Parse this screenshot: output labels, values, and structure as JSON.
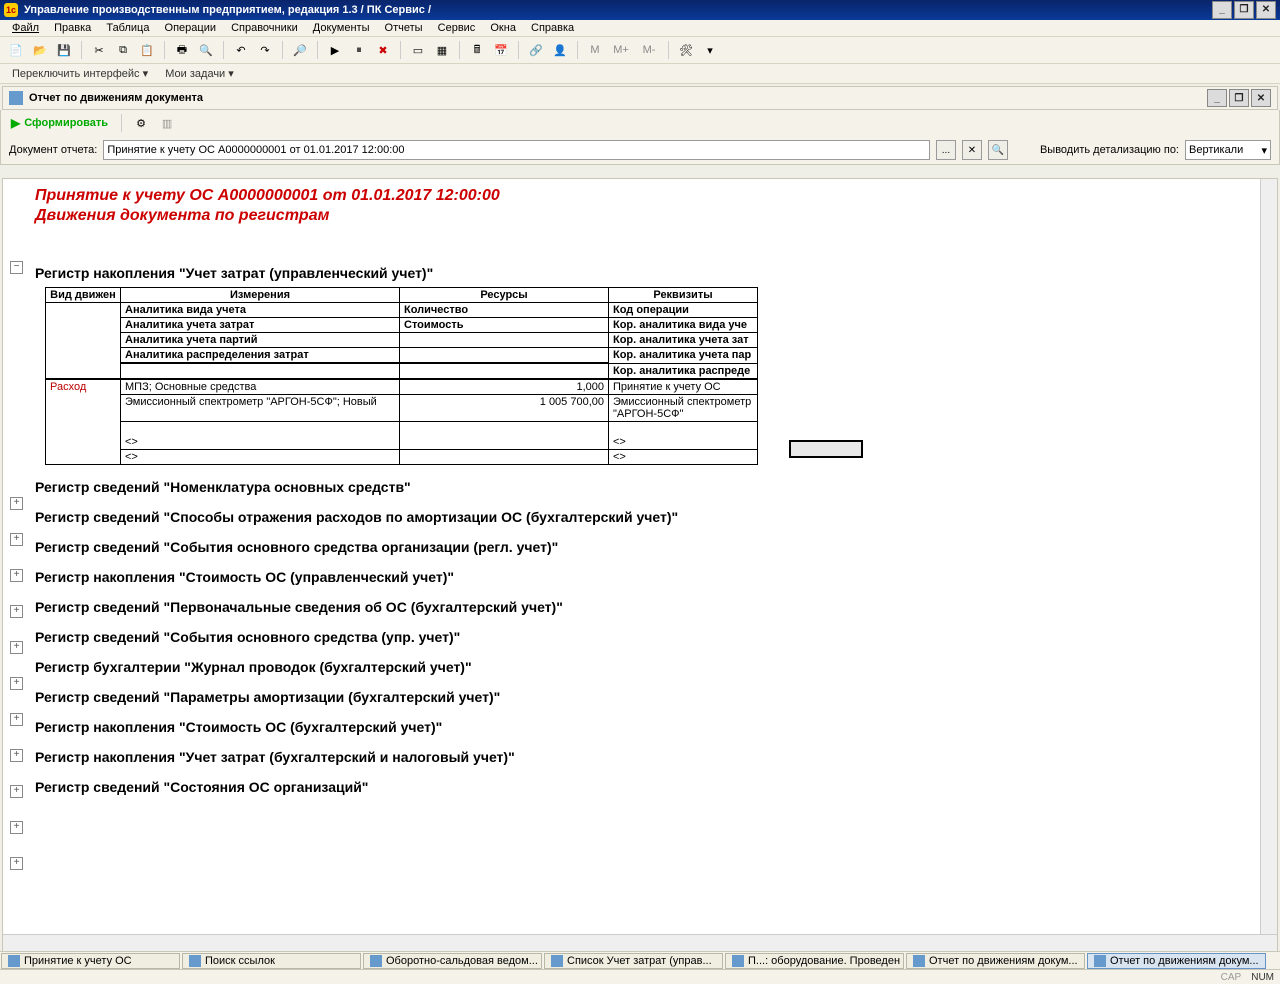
{
  "title": "Управление производственным предприятием, редакция 1.3 / ПК Сервис /",
  "menu": [
    "Файл",
    "Правка",
    "Таблица",
    "Операции",
    "Справочники",
    "Документы",
    "Отчеты",
    "Сервис",
    "Окна",
    "Справка"
  ],
  "toolbar_text": {
    "m": "М",
    "mplus": "М+",
    "mminus": "М-"
  },
  "linkbar": {
    "switch": "Переключить интерфейс",
    "tasks": "Мои задачи"
  },
  "subform_title": "Отчет по движениям документа",
  "btn_generate": "Сформировать",
  "filter": {
    "label": "Документ отчета:",
    "value": "Принятие к учету ОС А0000000001 от 01.01.2017 12:00:00",
    "detail_label": "Выводить детализацию по:",
    "detail_value": "Вертикали"
  },
  "report": {
    "head1": "Принятие к учету ОС А0000000001 от 01.01.2017 12:00:00",
    "head2": "Движения документа по регистрам",
    "section1": "Регистр накопления \"Учет затрат (управленческий учет)\"",
    "th": {
      "c1": "Вид движен",
      "c2": "Измерения",
      "c3": "Ресурсы",
      "c4": "Реквизиты",
      "r1a": "Аналитика вида учета",
      "r1b": "Количество",
      "r1c": "Код операции",
      "r2a": "Аналитика учета затрат",
      "r2b": "Стоимость",
      "r2c": "Кор. аналитика вида уче",
      "r3a": "Аналитика учета партий",
      "r3c": "Кор. аналитика учета зат",
      "r4a": "Аналитика распределения затрат",
      "r4c": "Кор. аналитика учета пар",
      "r5c": "Кор. аналитика распреде"
    },
    "row": {
      "kind": "Расход",
      "a1": "МПЗ; Основные средства",
      "v1": "1,000",
      "d1": "Принятие к учету ОС",
      "a2": "Эмиссионный спектрометр \"АРГОН-5СФ\"; Новый",
      "v2": "1 005 700,00",
      "d2": "Эмиссионный спектрометр \"АРГОН-5СФ\"",
      "a3": "<>",
      "d3": "<>",
      "a4": "<>",
      "d4": "<>"
    },
    "sections": [
      "Регистр сведений \"Номенклатура основных средств\"",
      "Регистр сведений \"Способы отражения расходов по амортизации ОС (бухгалтерский учет)\"",
      "Регистр сведений \"События основного средства организации (регл. учет)\"",
      "Регистр накопления \"Стоимость ОС (управленческий учет)\"",
      "Регистр сведений \"Первоначальные сведения об ОС (бухгалтерский учет)\"",
      "Регистр сведений \"События основного средства (упр. учет)\"",
      "Регистр бухгалтерии \"Журнал проводок (бухгалтерский учет)\"",
      "Регистр сведений \"Параметры амортизации (бухгалтерский учет)\"",
      "Регистр накопления \"Стоимость ОС (бухгалтерский учет)\"",
      "Регистр накопления \"Учет затрат (бухгалтерский и налоговый учет)\"",
      "Регистр сведений \"Состояния ОС организаций\""
    ]
  },
  "tasks": [
    "Принятие к учету ОС",
    "Поиск ссылок",
    "Оборотно-сальдовая ведом...",
    "Список Учет затрат (управ...",
    "П...: оборудование. Проведен",
    "Отчет по движениям докум...",
    "Отчет по движениям докум..."
  ],
  "status": {
    "cap": "CAP",
    "num": "NUM"
  }
}
